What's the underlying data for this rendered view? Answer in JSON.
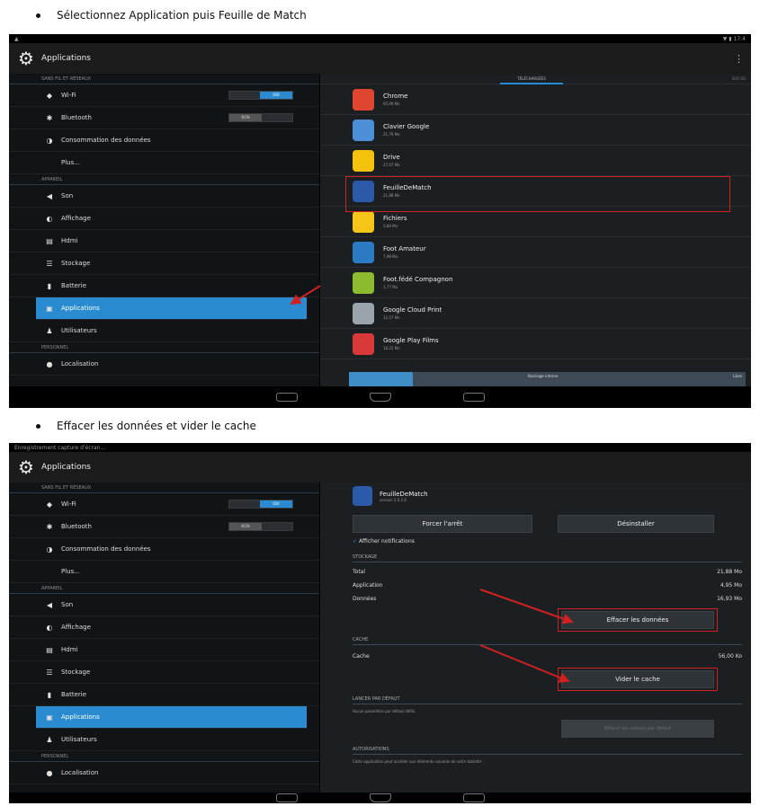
{
  "bullets": {
    "step1": "Sélectionnez Application puis Feuille de Match",
    "step2": "Effacer les données et vider le cache"
  },
  "shot1": {
    "status_right": "▼ ▮ 17:4",
    "title": "Applications",
    "menu": "⋮",
    "settings": {
      "section_network": "SANS FIL ET RÉSEAUX",
      "wifi": "Wi-Fi",
      "wifi_state": "OUI",
      "bluetooth": "Bluetooth",
      "bluetooth_state": "NON",
      "data_usage": "Consommation des données",
      "more": "Plus...",
      "section_device": "APPAREIL",
      "sound": "Son",
      "display": "Affichage",
      "hdmi": "Hdmi",
      "storage": "Stockage",
      "battery": "Batterie",
      "applications": "Applications",
      "users": "Utilisateurs",
      "section_personal": "PERSONNEL",
      "location": "Localisation"
    },
    "tab_active": "TÉLÉCHARGÉES",
    "tab_next": "SUR SD",
    "apps": [
      {
        "name": "Chrome",
        "size": "65,09 Mo",
        "color": "#e0452f"
      },
      {
        "name": "Clavier Google",
        "size": "21,79 Mo",
        "color": "#4d8fd6"
      },
      {
        "name": "Drive",
        "size": "27,07 Mo",
        "color": "#f4c20d"
      },
      {
        "name": "FeuilleDeMatch",
        "size": "21,88 Mo",
        "color": "#2d5aa8"
      },
      {
        "name": "Fichiers",
        "size": "3,84 Mo",
        "color": "#f5c518"
      },
      {
        "name": "Foot Amateur",
        "size": "7,98 Mo",
        "color": "#2b7cc4"
      },
      {
        "name": "Foot.fédé Compagnon",
        "size": "3,77 Mo",
        "color": "#8dbb2f"
      },
      {
        "name": "Google Cloud Print",
        "size": "12,57 Mo",
        "color": "#9aa4ad"
      },
      {
        "name": "Google Play Films",
        "size": "18,22 Mo",
        "color": "#d93838"
      }
    ],
    "storage_bar": {
      "label": "Stockage interne",
      "free": "Libre",
      "used_fraction": 0.16
    }
  },
  "shot2": {
    "status_left": "Enregistrement capture d'écran...",
    "title": "Applications",
    "settings": {
      "section_network": "SANS FIL ET RÉSEAUX",
      "wifi": "Wi-Fi",
      "wifi_state": "OUI",
      "bluetooth": "Bluetooth",
      "bluetooth_state": "NON",
      "data_usage": "Consommation des données",
      "more": "Plus...",
      "section_device": "APPAREIL",
      "sound": "Son",
      "display": "Affichage",
      "hdmi": "Hdmi",
      "storage": "Stockage",
      "battery": "Batterie",
      "applications": "Applications",
      "users": "Utilisateurs",
      "section_personal": "PERSONNEL",
      "location": "Localisation"
    },
    "detail": {
      "app_name": "FeuilleDeMatch",
      "version": "version 3.0.2.6",
      "force_stop": "Forcer l'arrêt",
      "uninstall": "Désinstaller",
      "show_notifications": "Afficher notifications",
      "section_storage": "STOCKAGE",
      "total_label": "Total",
      "total_value": "21,88 Mo",
      "app_label": "Application",
      "app_value": "4,95 Mo",
      "data_label": "Données",
      "data_value": "16,93 Mo",
      "clear_data": "Effacer les données",
      "section_cache": "CACHE",
      "cache_label": "Cache",
      "cache_value": "56,00 Ko",
      "clear_cache": "Vider le cache",
      "section_default": "LANCER PAR DÉFAUT",
      "default_text": "Aucun paramètre par défaut défini.",
      "clear_defaults": "Effacer les valeurs par défaut",
      "section_permissions": "AUTORISATIONS",
      "permissions_text": "Cette application peut accéder aux éléments suivants de votre tablette :"
    }
  },
  "colors": {
    "accent": "#2a8bd1",
    "highlight": "#d02020"
  }
}
